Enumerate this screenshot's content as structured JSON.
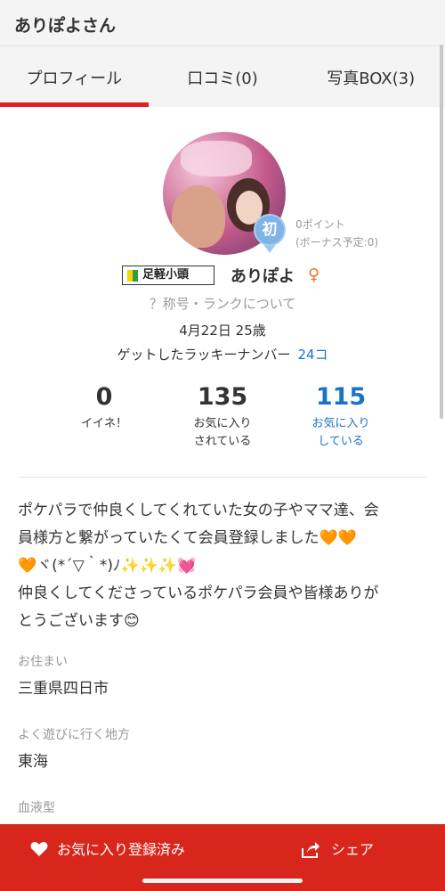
{
  "header": {
    "title": "ありぽよさん"
  },
  "tabs": [
    {
      "label": "プロフィール",
      "active": true
    },
    {
      "label": "口コミ(0)",
      "active": false
    },
    {
      "label": "写真BOX(3)",
      "active": false
    }
  ],
  "profile": {
    "badge_text": "初",
    "points": "0ポイント",
    "bonus": "(ボーナス予定:0)",
    "rank_title": "足軽小頭",
    "name": "ありぽよ",
    "gender_symbol": "♀",
    "rank_link": "？称号・ランクについて",
    "birthday": "4月22日 25歳",
    "lucky_label": "ゲットしたラッキーナンバー",
    "lucky_count": "24コ"
  },
  "stats": [
    {
      "value": "0",
      "label_line1": "イイネ！",
      "label_line2": ""
    },
    {
      "value": "135",
      "label_line1": "お気に入り",
      "label_line2": "されている"
    },
    {
      "value": "115",
      "label_line1": "お気に入り",
      "label_line2": "している"
    }
  ],
  "bio": {
    "line1": "ポケパラで仲良くしてくれていた女の子やママ達、会",
    "line2": "員様方と繋がっていたくて会員登録しました🧡🧡",
    "line3": "🧡ヾ(*´▽｀*)ﾉ✨✨✨💓",
    "line4": "仲良くしてくださっているポケパラ会員や皆様ありが",
    "line5": "とうございます😊"
  },
  "fields": {
    "residence_label": "お住まい",
    "residence_value": "三重県四日市",
    "area_label": "よく遊びに行く地方",
    "area_value": "東海",
    "blood_label": "血液型"
  },
  "bottom_bar": {
    "favorite_label": "お気に入り登録済み",
    "share_label": "シェア"
  },
  "colors": {
    "accent": "#e02020",
    "bottom_bar": "#d9261c",
    "link_blue": "#1a73c8"
  }
}
